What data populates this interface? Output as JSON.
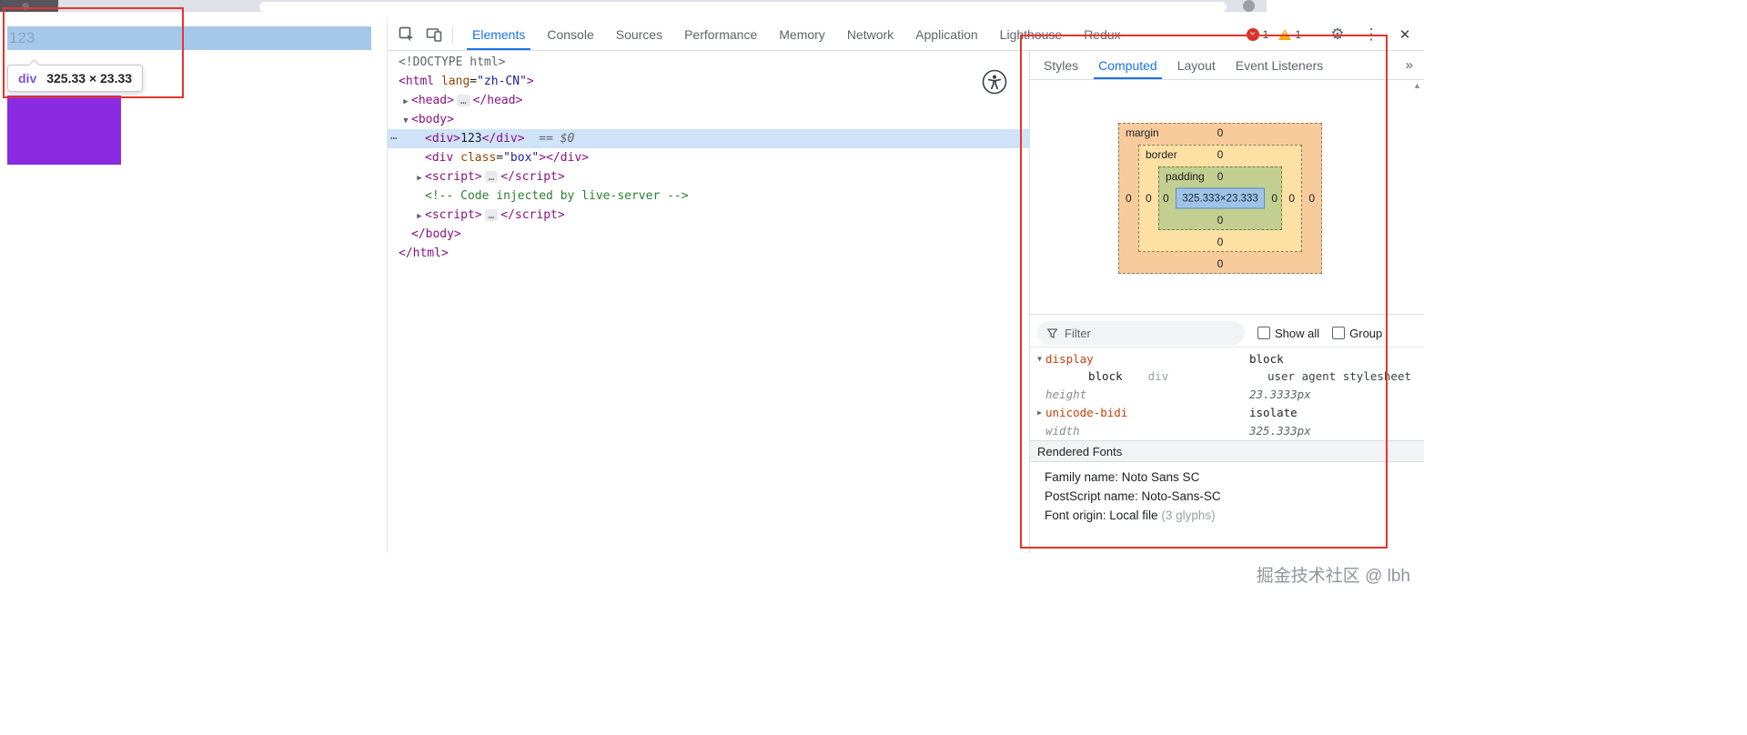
{
  "page": {
    "highlight_text": "123",
    "tooltip": {
      "tag": "div",
      "size": "325.33 × 23.33"
    }
  },
  "devtools": {
    "toolbar": {
      "tabs": [
        "Elements",
        "Console",
        "Sources",
        "Performance",
        "Memory",
        "Network",
        "Application",
        "Lighthouse",
        "Redux"
      ],
      "active_tab": "Elements",
      "error_count": "1",
      "warning_count": "1"
    },
    "tree": [
      {
        "indent": 0,
        "arrow": "",
        "tokens": [
          {
            "c": "doctype",
            "t": "<!DOCTYPE html>"
          }
        ]
      },
      {
        "indent": 0,
        "arrow": "",
        "tokens": [
          {
            "c": "tag",
            "t": "<html"
          },
          {
            "c": "attr",
            "t": " lang"
          },
          {
            "c": "punct",
            "t": "="
          },
          {
            "c": "val",
            "t": "\"zh-CN\""
          },
          {
            "c": "tag",
            "t": ">"
          }
        ]
      },
      {
        "indent": 1,
        "arrow": "▶",
        "tokens": [
          {
            "c": "tag",
            "t": "<head>"
          },
          {
            "c": "more",
            "t": "…"
          },
          {
            "c": "tag",
            "t": "</head>"
          }
        ]
      },
      {
        "indent": 1,
        "arrow": "▼",
        "tokens": [
          {
            "c": "tag",
            "t": "<body>"
          }
        ]
      },
      {
        "indent": 2,
        "arrow": "",
        "selected": true,
        "tokens": [
          {
            "c": "tag",
            "t": "<div>"
          },
          {
            "c": "text",
            "t": "123"
          },
          {
            "c": "tag",
            "t": "</div>"
          },
          {
            "c": "marker",
            "t": "  == $0"
          }
        ]
      },
      {
        "indent": 2,
        "arrow": "",
        "tokens": [
          {
            "c": "tag",
            "t": "<div"
          },
          {
            "c": "attr",
            "t": " class"
          },
          {
            "c": "punct",
            "t": "="
          },
          {
            "c": "val",
            "t": "\"box\""
          },
          {
            "c": "tag",
            "t": "></div>"
          }
        ]
      },
      {
        "indent": 2,
        "arrow": "▶",
        "tokens": [
          {
            "c": "tag",
            "t": "<script>"
          },
          {
            "c": "more",
            "t": "…"
          },
          {
            "c": "tag",
            "t": "</script>"
          }
        ]
      },
      {
        "indent": 2,
        "arrow": "",
        "tokens": [
          {
            "c": "comment",
            "t": "<!-- Code injected by live-server -->"
          }
        ]
      },
      {
        "indent": 2,
        "arrow": "▶",
        "tokens": [
          {
            "c": "tag",
            "t": "<script>"
          },
          {
            "c": "more",
            "t": "…"
          },
          {
            "c": "tag",
            "t": "</script>"
          }
        ]
      },
      {
        "indent": 1,
        "arrow": "",
        "tokens": [
          {
            "c": "tag",
            "t": "</body>"
          }
        ]
      },
      {
        "indent": 0,
        "arrow": "",
        "tokens": [
          {
            "c": "tag",
            "t": "</html>"
          }
        ]
      }
    ],
    "sidebar": {
      "tabs": [
        "Styles",
        "Computed",
        "Layout",
        "Event Listeners"
      ],
      "active_tab": "Computed",
      "overflow_icon": "»",
      "box_model": {
        "margin_label": "margin",
        "border_label": "border",
        "padding_label": "padding",
        "content": "325.333×23.333",
        "margin": {
          "top": "0",
          "right": "0",
          "bottom": "0",
          "left": "0"
        },
        "border": {
          "top": "0",
          "right": "0",
          "bottom": "0",
          "left": "0"
        },
        "padding": {
          "top": "0",
          "right": "0",
          "bottom": "0",
          "left": "0"
        }
      },
      "filter": {
        "placeholder": "Filter",
        "show_all": "Show all",
        "group": "Group"
      },
      "properties": [
        {
          "arrow": "▼",
          "name": "display",
          "value": "block",
          "implicit": false,
          "children": [
            {
              "value": "block",
              "tag": "div",
              "source": "user agent stylesheet"
            }
          ]
        },
        {
          "arrow": "",
          "name": "height",
          "value": "23.3333px",
          "implicit": true
        },
        {
          "arrow": "▶",
          "name": "unicode-bidi",
          "value": "isolate",
          "implicit": false
        },
        {
          "arrow": "",
          "name": "width",
          "value": "325.333px",
          "implicit": true
        }
      ],
      "rendered_fonts": {
        "title": "Rendered Fonts",
        "rows": [
          {
            "text": "Family name: Noto Sans SC",
            "suffix": ""
          },
          {
            "text": "PostScript name: Noto-Sans-SC",
            "suffix": ""
          },
          {
            "text": "Font origin: Local file",
            "suffix": " (3 glyphs)"
          }
        ]
      }
    }
  },
  "watermark": "掘金技术社区 @ lbh",
  "colors": {
    "accent_blue": "#1a73e8",
    "annotation_red": "#e5342c",
    "purple_box": "#8a2be2",
    "highlight_blue": "#a4c7ea",
    "box_margin": "#f8cb9d",
    "box_border": "#fce0a4",
    "box_padding": "#c2cf90",
    "box_content": "#9fc3e6"
  }
}
